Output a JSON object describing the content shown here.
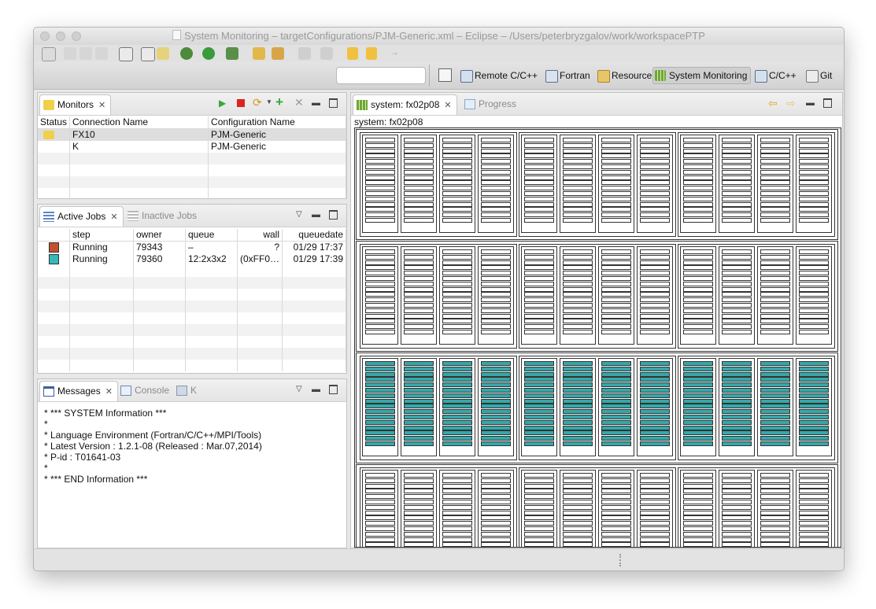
{
  "window": {
    "title": "System Monitoring – targetConfigurations/PJM-Generic.xml – Eclipse – /Users/peterbryzgalov/work/workspacePTP"
  },
  "toolbar": {
    "search_value": "",
    "perspectives": [
      {
        "label": "Remote C/C++",
        "icon": "remote-cpp-icon"
      },
      {
        "label": "Fortran",
        "icon": "fortran-icon"
      },
      {
        "label": "Resource",
        "icon": "resource-icon"
      },
      {
        "label": "System Monitoring",
        "icon": "system-monitoring-icon",
        "active": true
      },
      {
        "label": "C/C++",
        "icon": "cpp-icon"
      },
      {
        "label": "Git",
        "icon": "git-icon"
      }
    ]
  },
  "monitors": {
    "tab_label": "Monitors",
    "columns": [
      "Status",
      "Connection Name",
      "Configuration Name"
    ],
    "rows": [
      {
        "connection": "FX10",
        "configuration": "PJM-Generic",
        "status_icon": "connected-icon"
      },
      {
        "connection": "K",
        "configuration": "PJM-Generic",
        "status_icon": ""
      }
    ]
  },
  "jobs": {
    "active_tab": "Active Jobs",
    "inactive_tab": "Inactive Jobs",
    "columns": [
      "",
      "step",
      "owner",
      "queue",
      "wall",
      "queuedate"
    ],
    "rows": [
      {
        "color": "#c0522f",
        "step": "Running",
        "owner": "79343",
        "queue": "–",
        "wall": "?",
        "queuedate": "01/29 17:37"
      },
      {
        "color": "#36b8b8",
        "step": "Running",
        "owner": "79360",
        "queue": "12:2x3x2",
        "wall": "(0xFF0…",
        "queuedate": "01/29 17:39"
      }
    ]
  },
  "messages": {
    "tabs": [
      "Messages",
      "Console",
      "K"
    ],
    "lines": [
      "* *** SYSTEM Information ***",
      "*",
      "* Language Environment (Fortran/C/C++/MPI/Tools)",
      "* Latest Version : 1.2.1-08 (Released : Mar.07,2014)",
      "* P-id : T01641-03",
      "*",
      "* *** END Information ***"
    ]
  },
  "system_view": {
    "tab_label": "system: fx02p08",
    "progress_tab": "Progress",
    "header": "system: fx02p08",
    "cabinet_count": 4,
    "running_cabinets": [
      2
    ],
    "running_color": "#36a7a8",
    "boards_per_cabinet": 12,
    "nodes_per_board": 16
  }
}
